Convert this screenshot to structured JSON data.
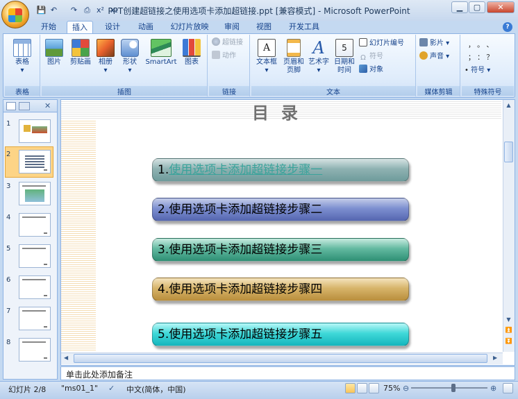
{
  "window": {
    "title": "PPT创建超链接之使用选项卡添加超链接.ppt [兼容模式] - Microsoft PowerPoint"
  },
  "quick_access": {
    "save": "💾",
    "undo": "↶",
    "redo": "↷",
    "print_preview": "⎙",
    "superscript": "x²",
    "subscript": "x₂"
  },
  "tabs": [
    "开始",
    "插入",
    "设计",
    "动画",
    "幻灯片放映",
    "审阅",
    "视图",
    "开发工具"
  ],
  "ribbon": {
    "tables": {
      "label": "表格",
      "table_btn": "表格"
    },
    "illustrations": {
      "label": "插图",
      "picture": "图片",
      "clipart": "剪贴画",
      "album": "相册",
      "shapes": "形状",
      "smartart": "SmartArt",
      "chart": "图表"
    },
    "links": {
      "label": "链接",
      "hyperlink": "超链接",
      "action": "动作"
    },
    "text": {
      "label": "文本",
      "textbox": "文本框",
      "header_footer_1": "页眉和",
      "header_footer_2": "页脚",
      "wordart": "艺术字",
      "datetime_1": "日期和",
      "datetime_2": "时间",
      "slide_number": "幻灯片编号",
      "symbol": "符号",
      "object": "对象"
    },
    "media": {
      "label": "媒体剪辑",
      "movie": "影片",
      "sound": "声音"
    },
    "special": {
      "label": "特殊符号",
      "symbol": "符号",
      "row1": "，  。  、",
      "row2": "；  ：  ？"
    }
  },
  "panel": {
    "close": "✕"
  },
  "thumbnails": [
    "1",
    "2",
    "3",
    "4",
    "5",
    "6",
    "7",
    "8"
  ],
  "slide": {
    "title": "目录",
    "items": [
      {
        "num": "1.",
        "text": "使用选项卡添加超链接步骤一"
      },
      {
        "num": "",
        "text": "2.使用选项卡添加超链接步骤二"
      },
      {
        "num": "",
        "text": "3.使用选项卡添加超链接步骤三"
      },
      {
        "num": "",
        "text": "4.使用选项卡添加超链接步骤四"
      },
      {
        "num": "",
        "text": "5.使用选项卡添加超链接步骤五"
      }
    ]
  },
  "notes": {
    "placeholder": "单击此处添加备注"
  },
  "status": {
    "slide": "幻灯片 2/8",
    "theme": "\"ms01_1\"",
    "language": "中文(简体，中国)",
    "zoom": "75%"
  },
  "colors": {
    "accent": "#15428b",
    "ribbon_bg": "#dfecfb",
    "selected_thumb": "#fdd486"
  }
}
